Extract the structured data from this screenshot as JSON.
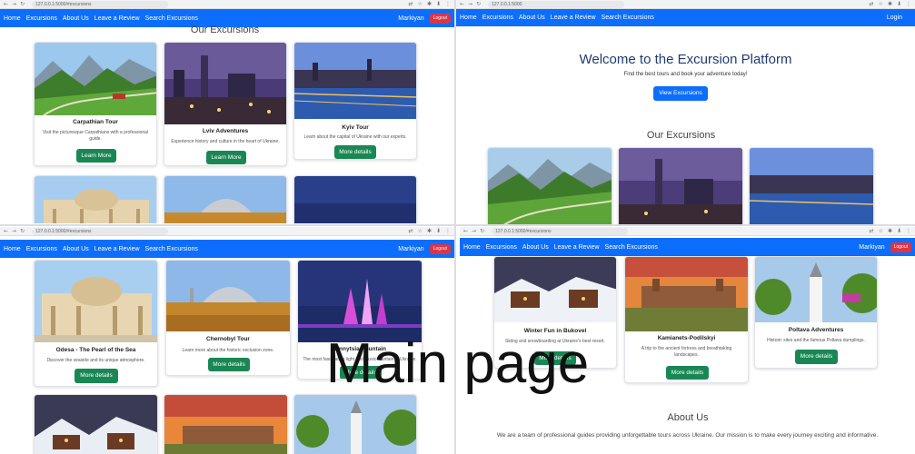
{
  "browser": {
    "url_top_left": "127.0.0.1:5000/#excursions",
    "url_top_right": "127.0.0.1:5000",
    "url_bottom_left": "127.0.0.1:5000/#excursions",
    "url_bottom_right": "127.0.0.1:5000/#excursions"
  },
  "nav": {
    "home": "Home",
    "excursions": "Excursions",
    "about": "About Us",
    "review": "Leave a Review",
    "search": "Search Excursions",
    "user": "Markiyan",
    "logout": "Logout",
    "login": "Login"
  },
  "section": {
    "excursions_title": "Our Excursions",
    "about_title": "About Us",
    "about_text": "We are a team of professional guides providing unforgettable tours across Ukraine. Our mission is to make every journey exciting and informative."
  },
  "hero": {
    "title": "Welcome to the Excursion Platform",
    "subtitle": "Find the best tours and book your adventure today!",
    "button": "View Excursions"
  },
  "cards": {
    "carpathian": {
      "title": "Carpathian Tour",
      "desc": "Visit the picturesque Carpathians with a professional guide.",
      "button": "Learn More"
    },
    "lviv": {
      "title": "Lviv Adventures",
      "desc": "Experience history and culture in the heart of Ukraine.",
      "button": "Learn More"
    },
    "kyiv": {
      "title": "Kyiv Tour",
      "desc": "Learn about the capital of Ukraine with our experts.",
      "button": "More details"
    },
    "odesa": {
      "title": "Odesa - The Pearl of the Sea",
      "desc": "Discover the seaside and its unique atmosphere.",
      "button": "More details"
    },
    "chernobyl": {
      "title": "Chernobyl Tour",
      "desc": "Learn more about the historic exclusion zone.",
      "button": "More details"
    },
    "vinnytsia": {
      "title": "Vinnytsia Fountain",
      "desc": "The most fascinating light and music fountain in Ukraine.",
      "button": "More details"
    },
    "bukovel": {
      "title": "Winter Fun in Bukovel",
      "desc": "Skiing and snowboarding at Ukraine's best resort.",
      "button": "More details"
    },
    "kamianets": {
      "title": "Kamianets-Podilskyi",
      "desc": "A trip to the ancient fortress and breathtaking landscapes.",
      "button": "More details"
    },
    "poltava": {
      "title": "Poltava Adventures",
      "desc": "Historic sites and the famous Poltava dumplings.",
      "button": "More details"
    }
  },
  "overlay_caption": "Main page",
  "icons": [
    "back-arrow-icon",
    "forward-arrow-icon",
    "reload-icon",
    "info-icon",
    "translate-icon",
    "star-icon",
    "extensions-icon",
    "download-icon",
    "menu-icon"
  ],
  "colors": {
    "navbar": "#0d6efd",
    "logout": "#dc3545",
    "details_button": "#198754",
    "primary_button": "#0d6efd"
  }
}
